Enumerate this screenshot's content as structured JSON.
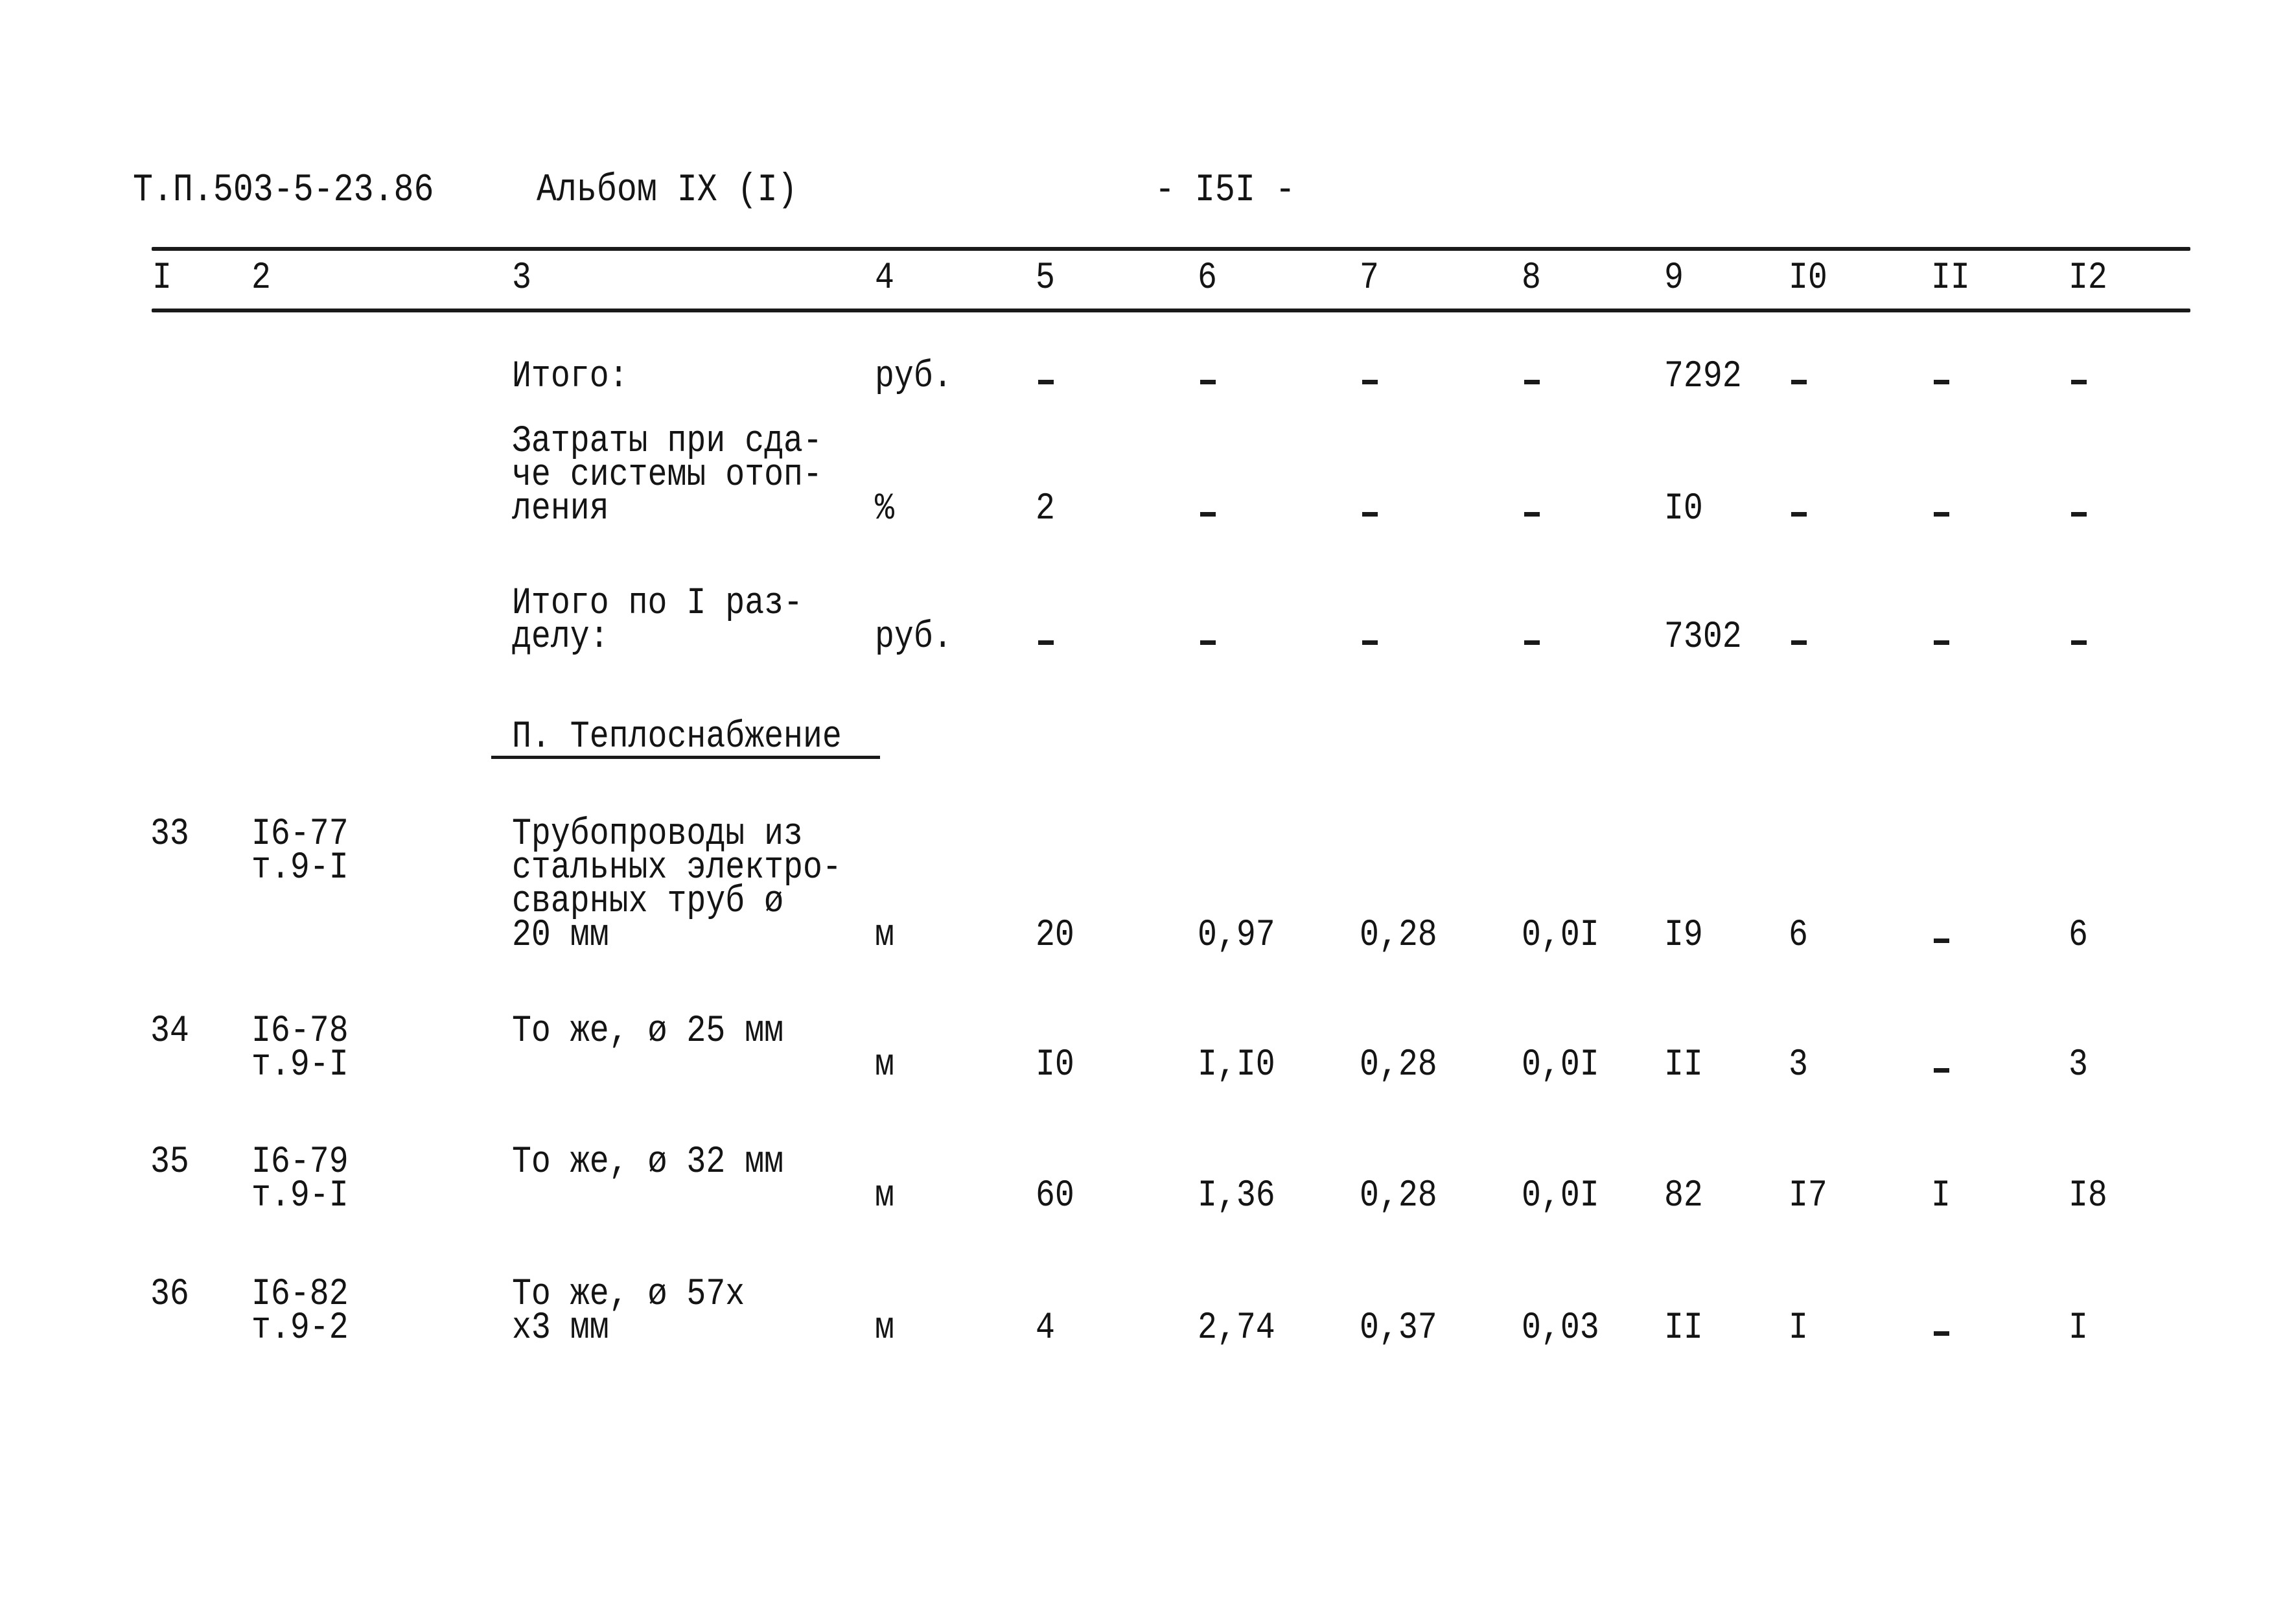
{
  "page_header": {
    "doc_code": "Т.П.503-5-23.86",
    "album": "Альбом IX (I)",
    "page_number": "- I5I -"
  },
  "column_headers": [
    "I",
    "2",
    "3",
    "4",
    "5",
    "6",
    "7",
    "8",
    "9",
    "I0",
    "II",
    "I2"
  ],
  "summary_rows": [
    {
      "label": [
        "Итого:"
      ],
      "unit": "руб.",
      "c5": "-",
      "c6": "-",
      "c7": "-",
      "c8": "-",
      "c9": "7292",
      "c10": "-",
      "c11": "-",
      "c12": "-"
    },
    {
      "label": [
        "Затраты при сда-",
        "че системы отоп-",
        "ления"
      ],
      "unit": "%",
      "c5": "2",
      "c6": "-",
      "c7": "-",
      "c8": "-",
      "c9": "I0",
      "c10": "-",
      "c11": "-",
      "c12": "-"
    },
    {
      "label": [
        "Итого по I раз-",
        "делу:"
      ],
      "unit": "руб.",
      "c5": "-",
      "c6": "-",
      "c7": "-",
      "c8": "-",
      "c9": "7302",
      "c10": "-",
      "c11": "-",
      "c12": "-"
    }
  ],
  "section_title": "П. Теплоснабжение",
  "rows": [
    {
      "num": "33",
      "code": [
        "I6-77",
        "т.9-I"
      ],
      "name": [
        "Трубопроводы из",
        "стальных электро-",
        "сварных труб ø",
        "20 мм"
      ],
      "unit": "м",
      "c5": "20",
      "c6": "0,97",
      "c7": "0,28",
      "c8": "0,0I",
      "c9": "I9",
      "c10": "6",
      "c11": "-",
      "c12": "6"
    },
    {
      "num": "34",
      "code": [
        "I6-78",
        "т.9-I"
      ],
      "name": [
        "То же, ø 25 мм"
      ],
      "unit": "м",
      "c5": "I0",
      "c6": "I,I0",
      "c7": "0,28",
      "c8": "0,0I",
      "c9": "II",
      "c10": "3",
      "c11": "-",
      "c12": "3"
    },
    {
      "num": "35",
      "code": [
        "I6-79",
        "т.9-I"
      ],
      "name": [
        "То же, ø 32 мм"
      ],
      "unit": "м",
      "c5": "60",
      "c6": "I,36",
      "c7": "0,28",
      "c8": "0,0I",
      "c9": "82",
      "c10": "I7",
      "c11": "I",
      "c12": "I8"
    },
    {
      "num": "36",
      "code": [
        "I6-82",
        "т.9-2"
      ],
      "name": [
        "То же, ø 57х",
        "х3 мм"
      ],
      "unit": "м",
      "c5": "4",
      "c6": "2,74",
      "c7": "0,37",
      "c8": "0,03",
      "c9": "II",
      "c10": "I",
      "c11": "-",
      "c12": "I"
    }
  ]
}
